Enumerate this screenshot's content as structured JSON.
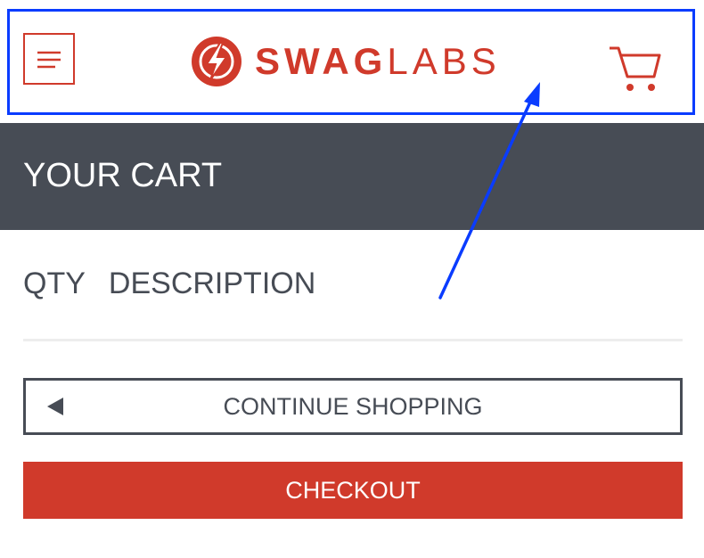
{
  "header": {
    "menu_icon": "hamburger-menu-icon",
    "logo": {
      "icon": "lightning-bolt-icon",
      "text_bold": "SWAG",
      "text_light": "LABS"
    },
    "cart_icon": "shopping-cart-icon"
  },
  "title_bar": {
    "title": "YOUR CART"
  },
  "cart_list": {
    "qty_header": "QTY",
    "description_header": "DESCRIPTION"
  },
  "actions": {
    "continue_icon": "left-arrow-icon",
    "continue_label": "CONTINUE SHOPPING",
    "checkout_label": "CHECKOUT"
  },
  "annotation": {
    "highlight_color": "#0a3cff",
    "arrow_color": "#0a3cff"
  },
  "colors": {
    "brand": "#d03a2b",
    "title_bar_bg": "#474c55",
    "text_dark": "#474c55",
    "divider": "#ededed"
  }
}
